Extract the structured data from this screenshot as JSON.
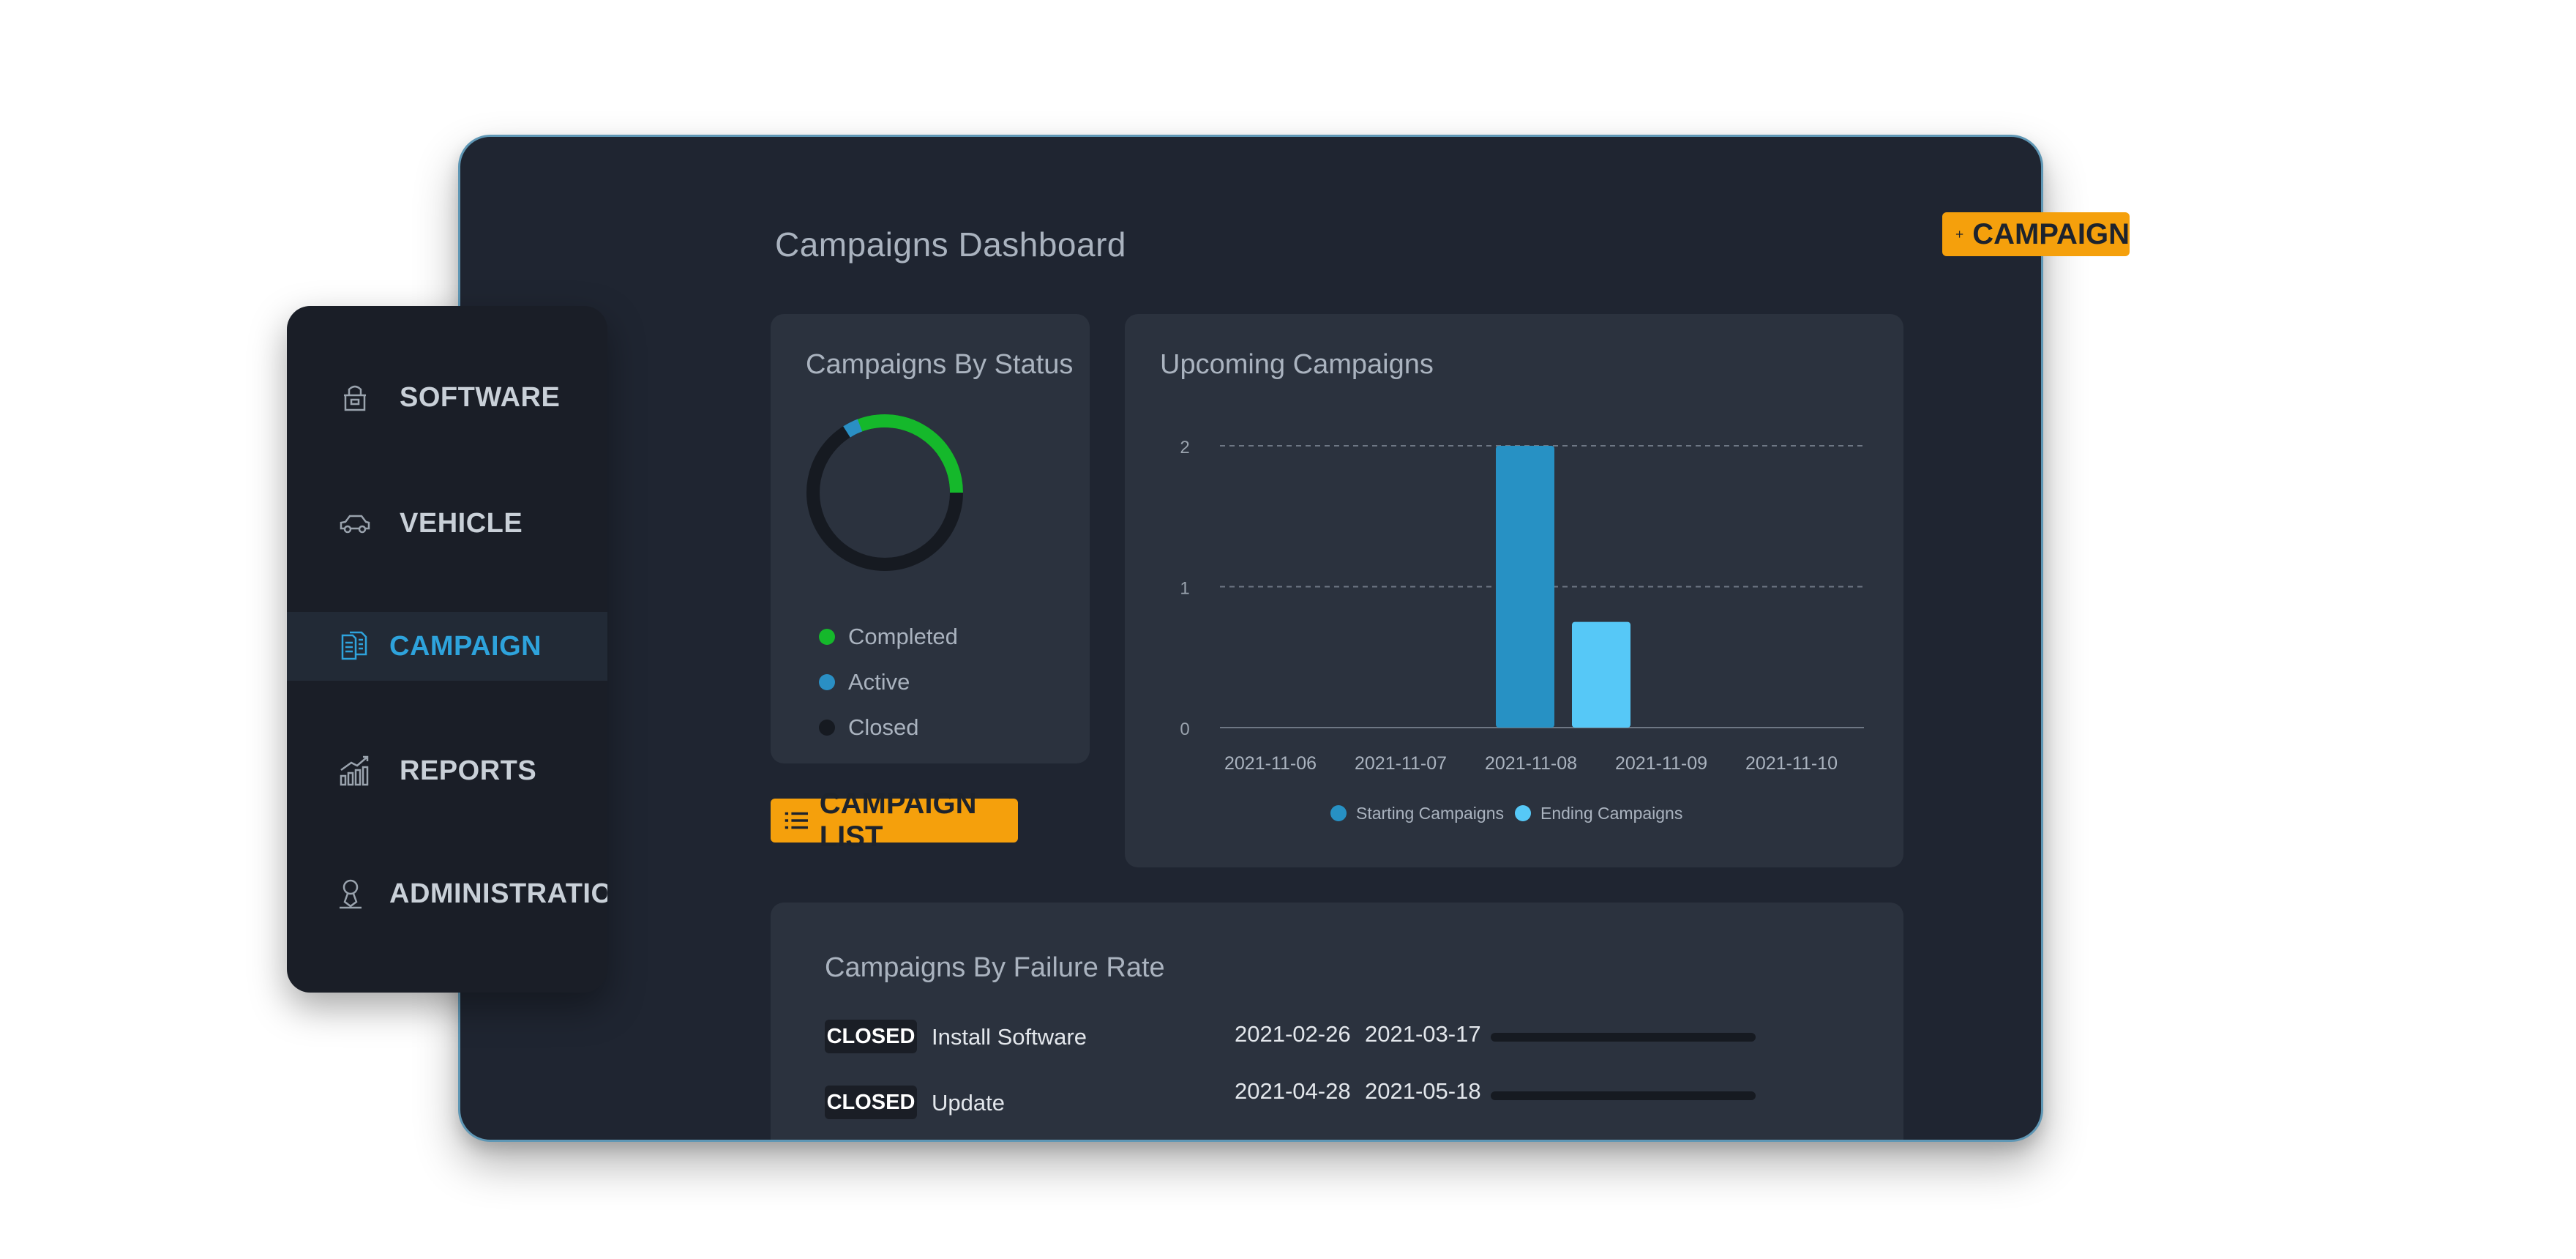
{
  "page": {
    "title": "Campaigns Dashboard"
  },
  "add_button": {
    "label": "CAMPAIGN",
    "icon": "plus-icon"
  },
  "sidebar": {
    "items": [
      {
        "label": "SOFTWARE",
        "icon": "software-package-icon",
        "active": false
      },
      {
        "label": "VEHICLE",
        "icon": "car-icon",
        "active": false
      },
      {
        "label": "CAMPAIGN",
        "icon": "documents-icon",
        "active": true
      },
      {
        "label": "REPORTS",
        "icon": "chart-growth-icon",
        "active": false
      },
      {
        "label": "ADMINISTRATION",
        "icon": "user-icon",
        "active": false
      }
    ]
  },
  "status_card": {
    "title": "Campaigns By Status",
    "legend": [
      {
        "label": "Completed",
        "color": "#15b82b"
      },
      {
        "label": "Active",
        "color": "#2a8fc4"
      },
      {
        "label": "Closed",
        "color": "#161a21"
      }
    ]
  },
  "list_button": {
    "label": "CAMPAIGN LIST",
    "icon": "list-icon"
  },
  "upcoming_card": {
    "title": "Upcoming Campaigns"
  },
  "chart_data": {
    "type": "bar",
    "title": "Upcoming Campaigns",
    "categories": [
      "2021-11-06",
      "2021-11-07",
      "2021-11-08",
      "2021-11-09",
      "2021-11-10"
    ],
    "series": [
      {
        "name": "Starting Campaigns",
        "color": "#2791c4",
        "values": [
          0,
          0,
          2,
          0,
          0
        ]
      },
      {
        "name": "Ending Campaigns",
        "color": "#56c8f7",
        "values": [
          0,
          0,
          0.75,
          0,
          0
        ]
      }
    ],
    "yticks": [
      "0",
      "1",
      "2"
    ],
    "ylim": [
      0,
      2
    ],
    "grid": true,
    "legend_position": "bottom"
  },
  "failure_card": {
    "title": "Campaigns By Failure Rate",
    "rows": [
      {
        "status": "CLOSED",
        "name": "Install Software",
        "start": "2021-02-26",
        "end": "2021-03-17",
        "failure_rate": 0
      },
      {
        "status": "CLOSED",
        "name": "Update",
        "start": "2021-04-28",
        "end": "2021-05-18",
        "failure_rate": 0
      }
    ]
  },
  "colors": {
    "accent": "#f5a00c",
    "active_nav": "#2ea3dc",
    "background": "#1f2531",
    "card": "#2b323e"
  }
}
